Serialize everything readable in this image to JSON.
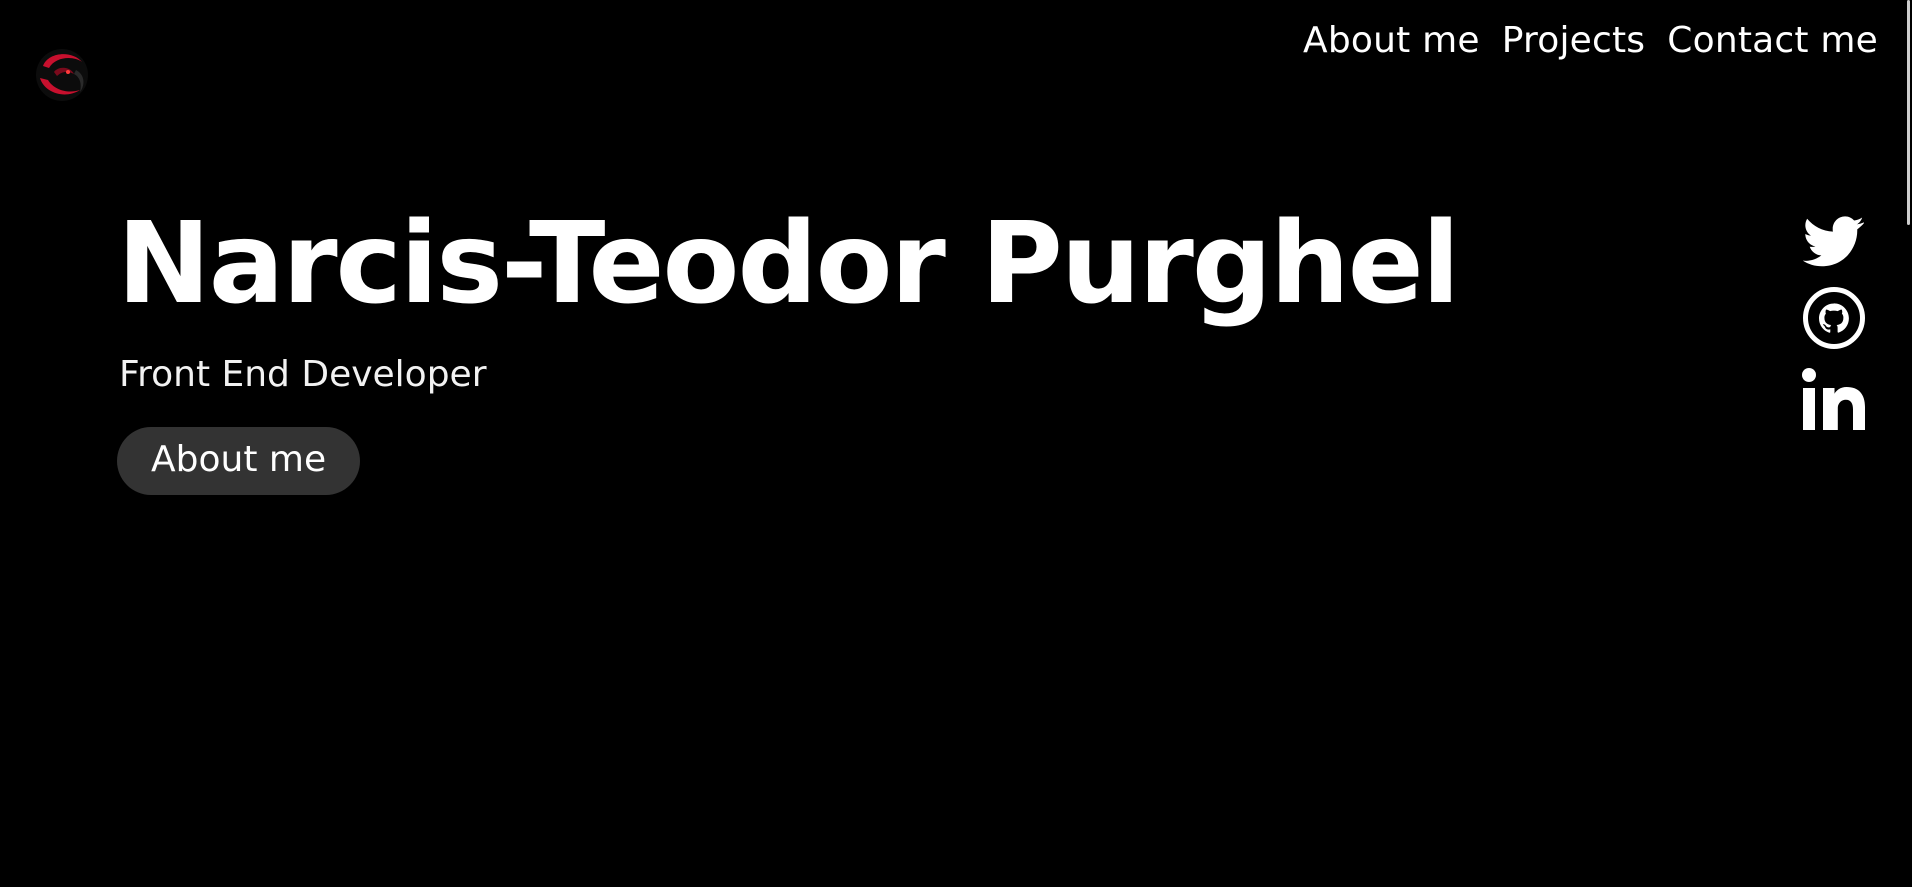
{
  "header": {
    "logo_name": "dragon-logo",
    "nav": {
      "about": "About me",
      "projects": "Projects",
      "contact": "Contact me"
    }
  },
  "hero": {
    "name": "Narcis-Teodor Purghel",
    "subtitle": "Front End Developer",
    "button_label": "About me"
  },
  "social": {
    "icons": [
      "twitter-icon",
      "github-icon",
      "linkedin-icon"
    ]
  },
  "colors": {
    "background": "#000000",
    "text": "#ffffff",
    "button_bg": "#333333",
    "logo_accent": "#c8102e"
  }
}
